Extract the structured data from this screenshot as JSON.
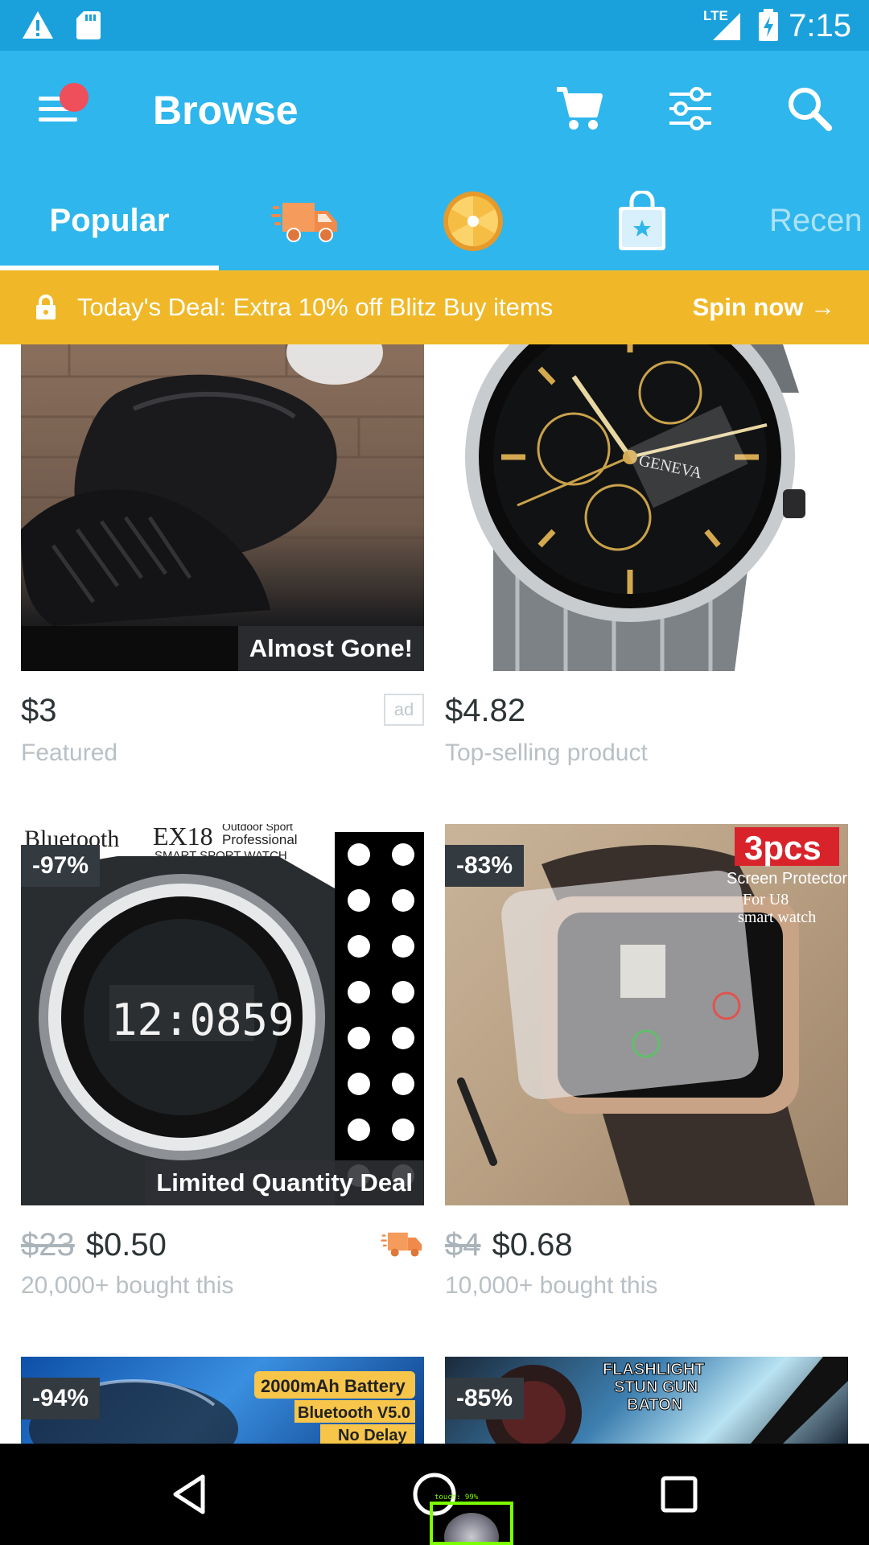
{
  "status_bar": {
    "time": "7:15",
    "network": "LTE",
    "icons": [
      "warning-icon",
      "sd-card-icon",
      "signal-icon",
      "battery-charging-icon"
    ]
  },
  "toolbar": {
    "title": "Browse",
    "buttons": [
      "cart-icon",
      "filter-icon",
      "search-icon"
    ]
  },
  "tabs": [
    {
      "label": "Popular",
      "selected": true
    },
    {
      "icon": "fast-shipping-icon"
    },
    {
      "icon": "spin-wheel-icon"
    },
    {
      "icon": "shopping-bag-star-icon"
    },
    {
      "label": "Recen"
    }
  ],
  "deal_banner": {
    "text": "Today's Deal: Extra 10% off Blitz Buy items",
    "action": "Spin now →"
  },
  "products": [
    {
      "image": "black leather slip-on shoe",
      "badge_bottom": "Almost Gone!",
      "price": "$3",
      "subtitle": "Featured",
      "ad": "ad"
    },
    {
      "image": "black chronograph wrist watch",
      "price": "$4.82",
      "subtitle": "Top-selling product"
    },
    {
      "image": "EX18 bluetooth sport watch",
      "discount": "-97%",
      "badge_bottom": "Limited Quantity Deal",
      "old_price": "$23",
      "price": "$0.50",
      "subtitle": "20,000+ bought this",
      "shipping_icon": "fast-shipping-icon"
    },
    {
      "image": "U8 smart watch screen protector",
      "discount": "-83%",
      "old_price": "$4",
      "price": "$0.68",
      "subtitle": "10,000+ bought this"
    },
    {
      "image": "bluetooth earbuds case",
      "discount": "-94%",
      "image_text": [
        "2000mAh Battery",
        "Bluetooth V5.0",
        "No Delay"
      ]
    },
    {
      "image": "flashlight stun gun baton",
      "discount": "-85%",
      "image_text": [
        "FLASHLIGHT",
        "STUN GUN",
        "BATON"
      ]
    }
  ],
  "product_images": {
    "watch1_logo": "GENEVA",
    "watch2_brand": "Bluetooth",
    "watch2_model": "EX18",
    "watch2_tag1": "Outdoor Sport",
    "watch2_tag2": "Professional",
    "watch2_tag3": "SMART SPORT WATCH",
    "watch2_time": "12:0859",
    "protector_count": "3pcs",
    "protector_line1": "Screen Protector",
    "protector_line2": "For U8",
    "protector_line3": "smart watch"
  },
  "nav_bar": {
    "buttons": [
      "back-icon",
      "home-icon",
      "recents-icon"
    ]
  },
  "touch_indicator": {
    "label": "touch: 99%"
  }
}
